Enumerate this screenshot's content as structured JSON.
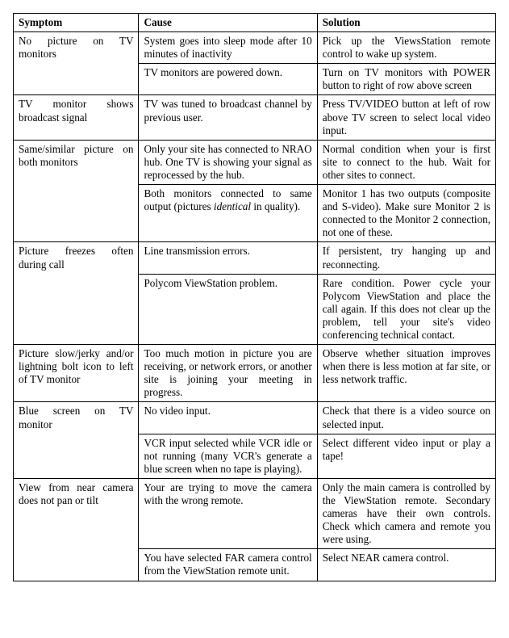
{
  "headers": {
    "symptom": "Symptom",
    "cause": "Cause",
    "solution": "Solution"
  },
  "rows": [
    {
      "symptom": "No picture on TV monitors",
      "items": [
        {
          "cause": "System goes into sleep mode after 10 minutes of inactivity",
          "solution": "Pick up the ViewsStation remote control to wake up system."
        },
        {
          "cause": "TV monitors are powered down.",
          "solution": "Turn on TV monitors with POWER button to right of row above screen"
        }
      ]
    },
    {
      "symptom": "TV monitor shows broadcast signal",
      "items": [
        {
          "cause": "TV was tuned to broadcast channel by previous user.",
          "solution": "Press TV/VIDEO button at left of row above TV screen to select local video input."
        }
      ]
    },
    {
      "symptom": "Same/similar picture on both monitors",
      "items": [
        {
          "cause": "Only your site has connected to NRAO hub. One TV is showing your signal as reprocessed by the hub.",
          "solution": "Normal condition when your is first site to connect to the hub. Wait for other sites to connect."
        },
        {
          "cause": "Both monitors connected to same output (pictures <em>identical</em> in quality).",
          "solution": "Monitor 1 has two outputs (composite and S-video). Make sure Monitor 2 is connected to the Monitor 2 connection, not one of these."
        }
      ]
    },
    {
      "symptom": "Picture freezes often during call",
      "items": [
        {
          "cause": "Line transmission errors.",
          "solution": "If persistent, try hanging up and reconnecting."
        },
        {
          "cause": "Polycom ViewStation problem.",
          "solution": "Rare condition. Power cycle your Polycom ViewStation and place the call again. If this does not clear up the problem, tell your site's video conferencing technical contact."
        }
      ]
    },
    {
      "symptom": "Picture slow/jerky and/or lightning bolt icon to left of TV monitor",
      "items": [
        {
          "cause": "Too much motion in picture you are receiving, or network errors, or another site is joining your meeting in progress.",
          "solution": "Observe whether situation improves when there is less motion at far site, or less network traffic."
        }
      ]
    },
    {
      "symptom": "Blue screen on TV monitor",
      "items": [
        {
          "cause": "No video input.",
          "solution": "Check that there is a video source on selected input."
        },
        {
          "cause": "VCR input selected while VCR idle or not running (many VCR's generate a blue screen when no tape is playing).",
          "solution": "Select different video input or play a tape!"
        }
      ]
    },
    {
      "symptom": "View from near camera does not pan or tilt",
      "items": [
        {
          "cause": "Your are trying to move the camera with the wrong remote.",
          "solution": "Only the main camera is controlled by the ViewStation remote. Secondary cameras have their own controls. Check which camera and remote you were using."
        },
        {
          "cause": "You have selected FAR camera control from the ViewStation remote unit.",
          "solution": "Select NEAR camera control."
        }
      ]
    }
  ]
}
